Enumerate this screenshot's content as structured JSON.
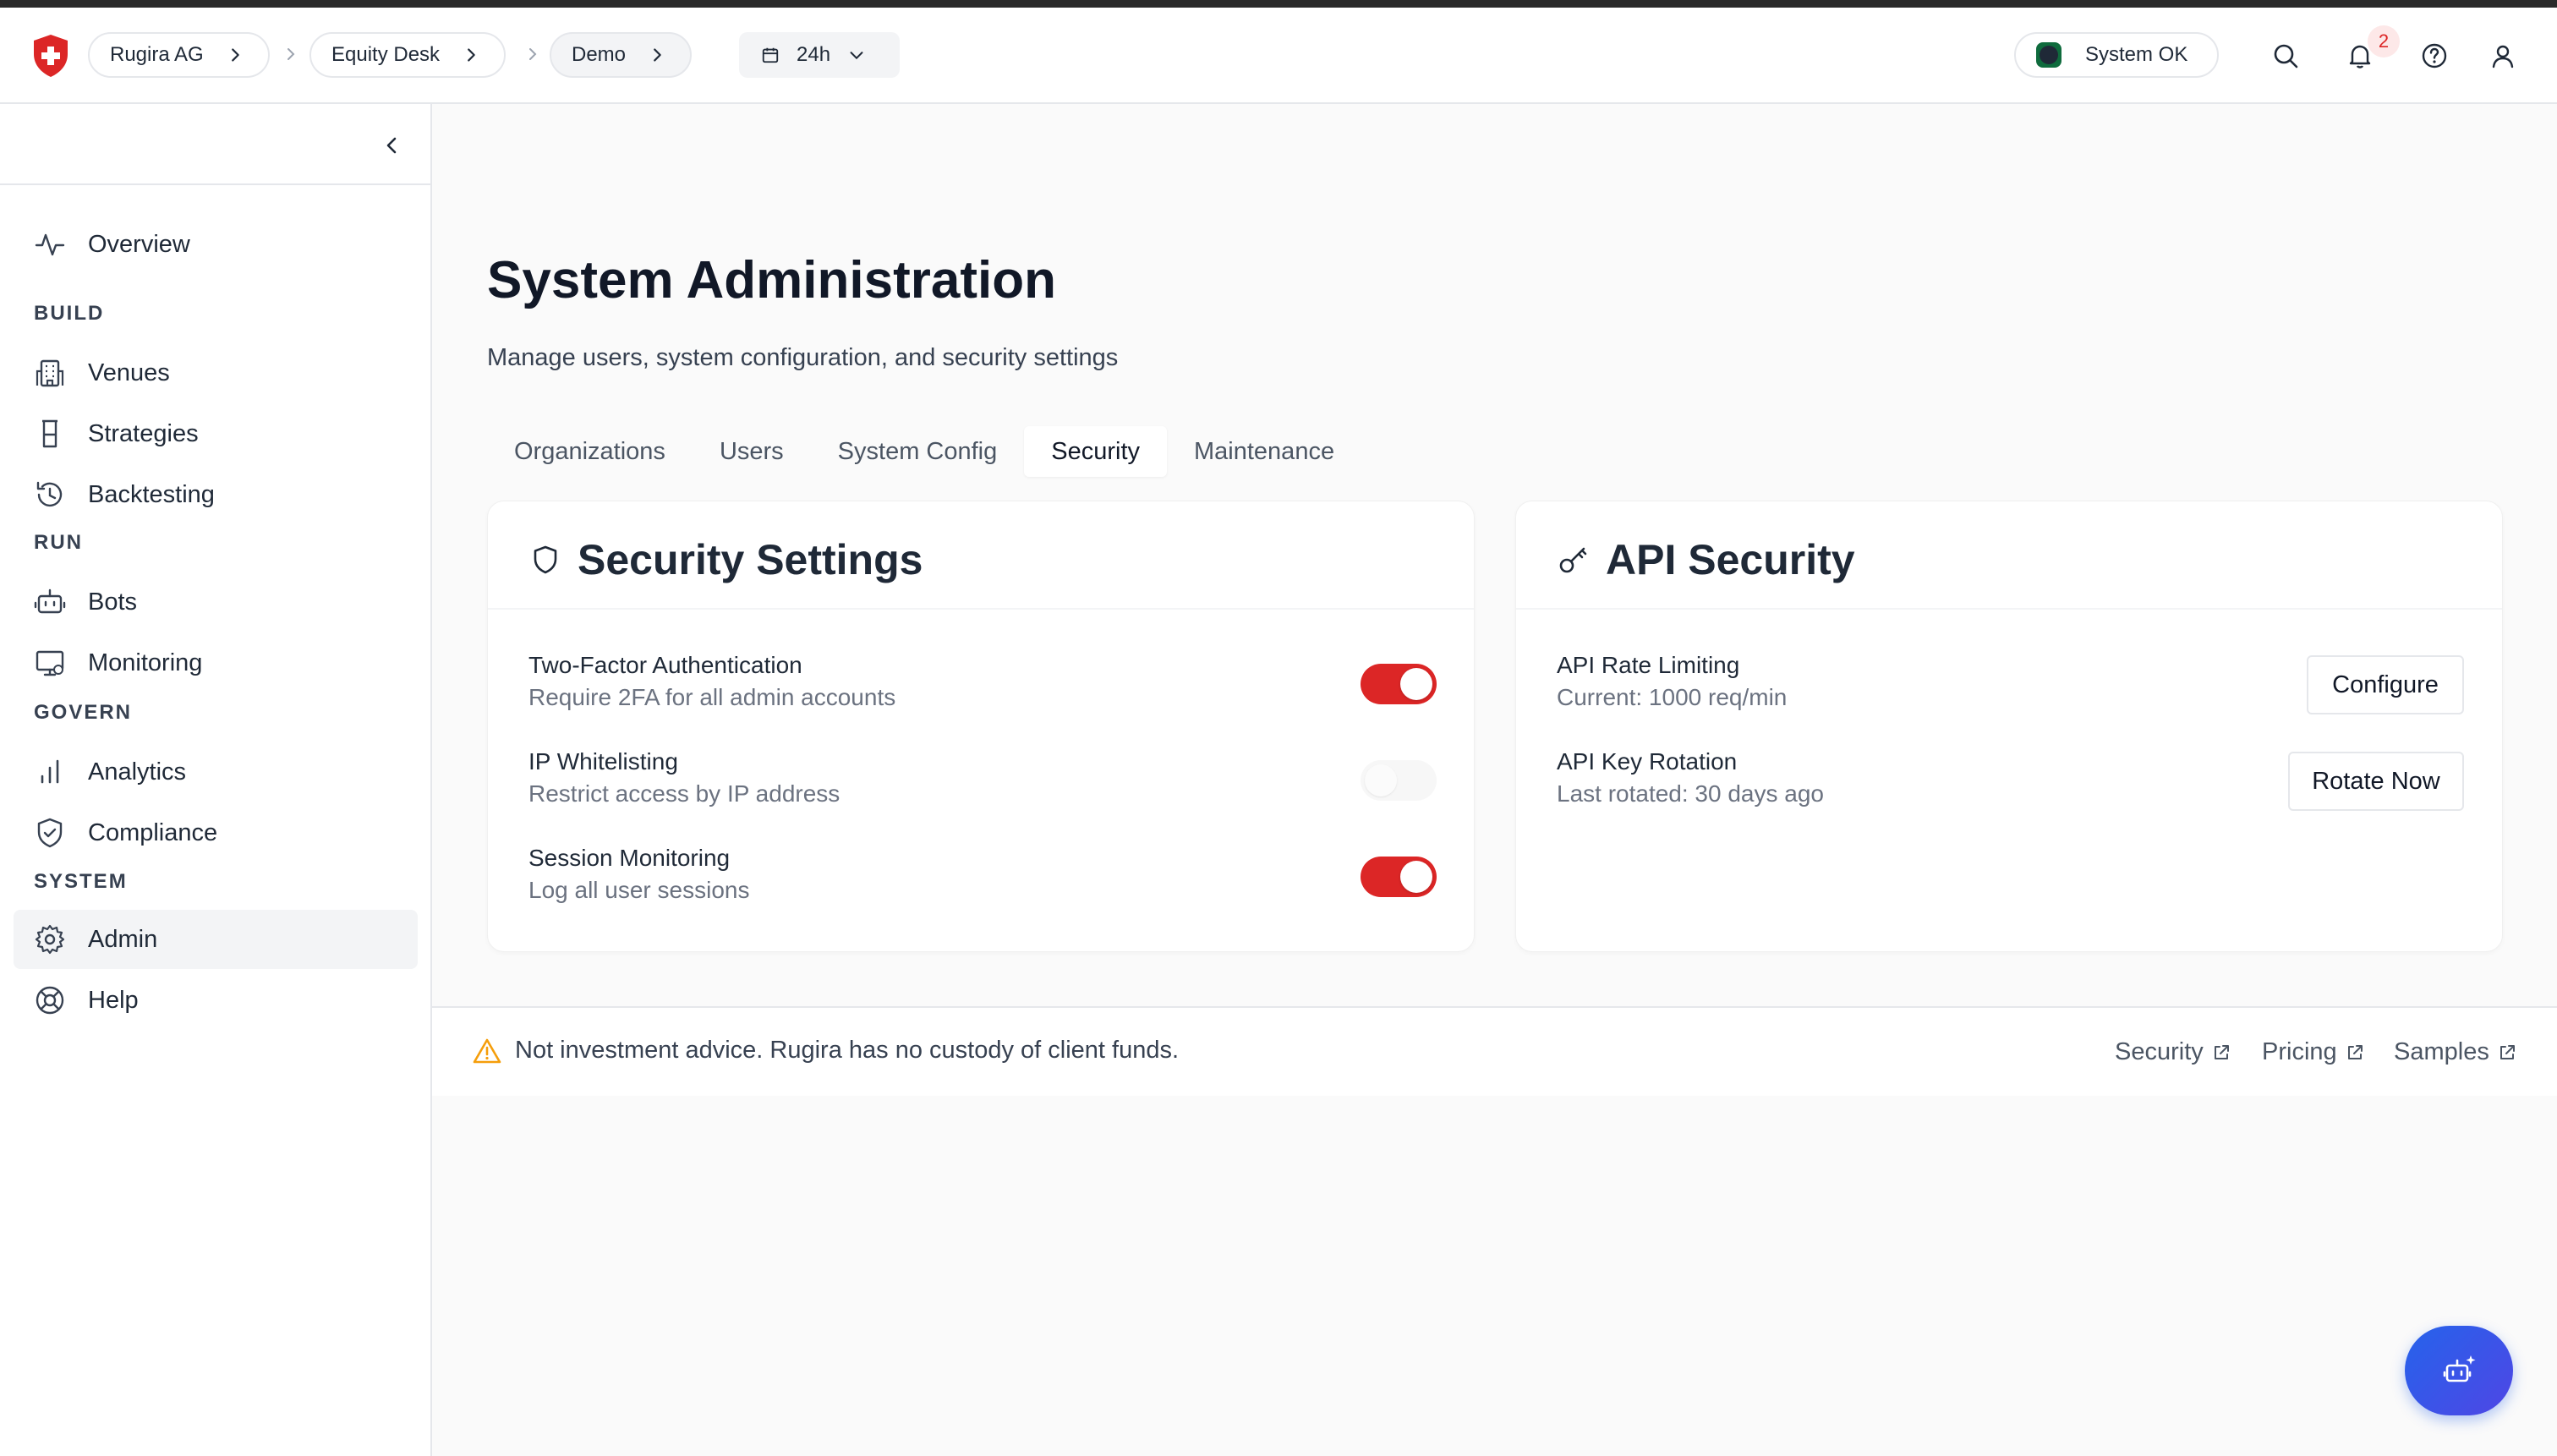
{
  "header": {
    "breadcrumbs": [
      {
        "label": "Rugira AG"
      },
      {
        "label": "Equity Desk"
      },
      {
        "label": "Demo"
      }
    ],
    "time_range": "24h",
    "status_label": "System OK",
    "notification_count": "2",
    "icons": [
      "shield-logo-icon",
      "calendar-icon",
      "search-icon",
      "bell-icon",
      "help-icon",
      "user-icon"
    ]
  },
  "sidebar": {
    "top_items": [
      {
        "label": "Overview",
        "icon": "activity-icon"
      }
    ],
    "sections": [
      {
        "label": "BUILD",
        "items": [
          {
            "label": "Venues",
            "icon": "building-icon"
          },
          {
            "label": "Strategies",
            "icon": "flask-icon"
          },
          {
            "label": "Backtesting",
            "icon": "history-icon"
          }
        ]
      },
      {
        "label": "RUN",
        "items": [
          {
            "label": "Bots",
            "icon": "bot-icon"
          },
          {
            "label": "Monitoring",
            "icon": "monitor-icon"
          }
        ]
      },
      {
        "label": "GOVERN",
        "items": [
          {
            "label": "Analytics",
            "icon": "bar-chart-icon"
          },
          {
            "label": "Compliance",
            "icon": "shield-check-icon"
          }
        ]
      },
      {
        "label": "SYSTEM",
        "items": [
          {
            "label": "Admin",
            "icon": "gear-icon",
            "active": true
          },
          {
            "label": "Help",
            "icon": "lifebuoy-icon"
          }
        ]
      }
    ]
  },
  "page": {
    "title": "System Administration",
    "subtitle": "Manage users, system configuration, and security settings",
    "tabs": [
      {
        "label": "Organizations"
      },
      {
        "label": "Users"
      },
      {
        "label": "System Config"
      },
      {
        "label": "Security",
        "active": true
      },
      {
        "label": "Maintenance"
      }
    ]
  },
  "security_settings": {
    "title": "Security Settings",
    "items": [
      {
        "title": "Two-Factor Authentication",
        "desc": "Require 2FA for all admin accounts",
        "enabled": true
      },
      {
        "title": "IP Whitelisting",
        "desc": "Restrict access by IP address",
        "enabled": false
      },
      {
        "title": "Session Monitoring",
        "desc": "Log all user sessions",
        "enabled": true
      }
    ]
  },
  "api_security": {
    "title": "API Security",
    "items": [
      {
        "title": "API Rate Limiting",
        "desc": "Current: 1000 req/min",
        "action": "Configure"
      },
      {
        "title": "API Key Rotation",
        "desc": "Last rotated: 30 days ago",
        "action": "Rotate Now"
      }
    ]
  },
  "footer": {
    "disclaimer": "Not investment advice. Rugira has no custody of client funds.",
    "links": [
      {
        "label": "Security"
      },
      {
        "label": "Pricing"
      },
      {
        "label": "Samples"
      }
    ]
  },
  "colors": {
    "accent": "#dc2626",
    "fab": "#2563eb",
    "warning": "#f59e0b"
  }
}
